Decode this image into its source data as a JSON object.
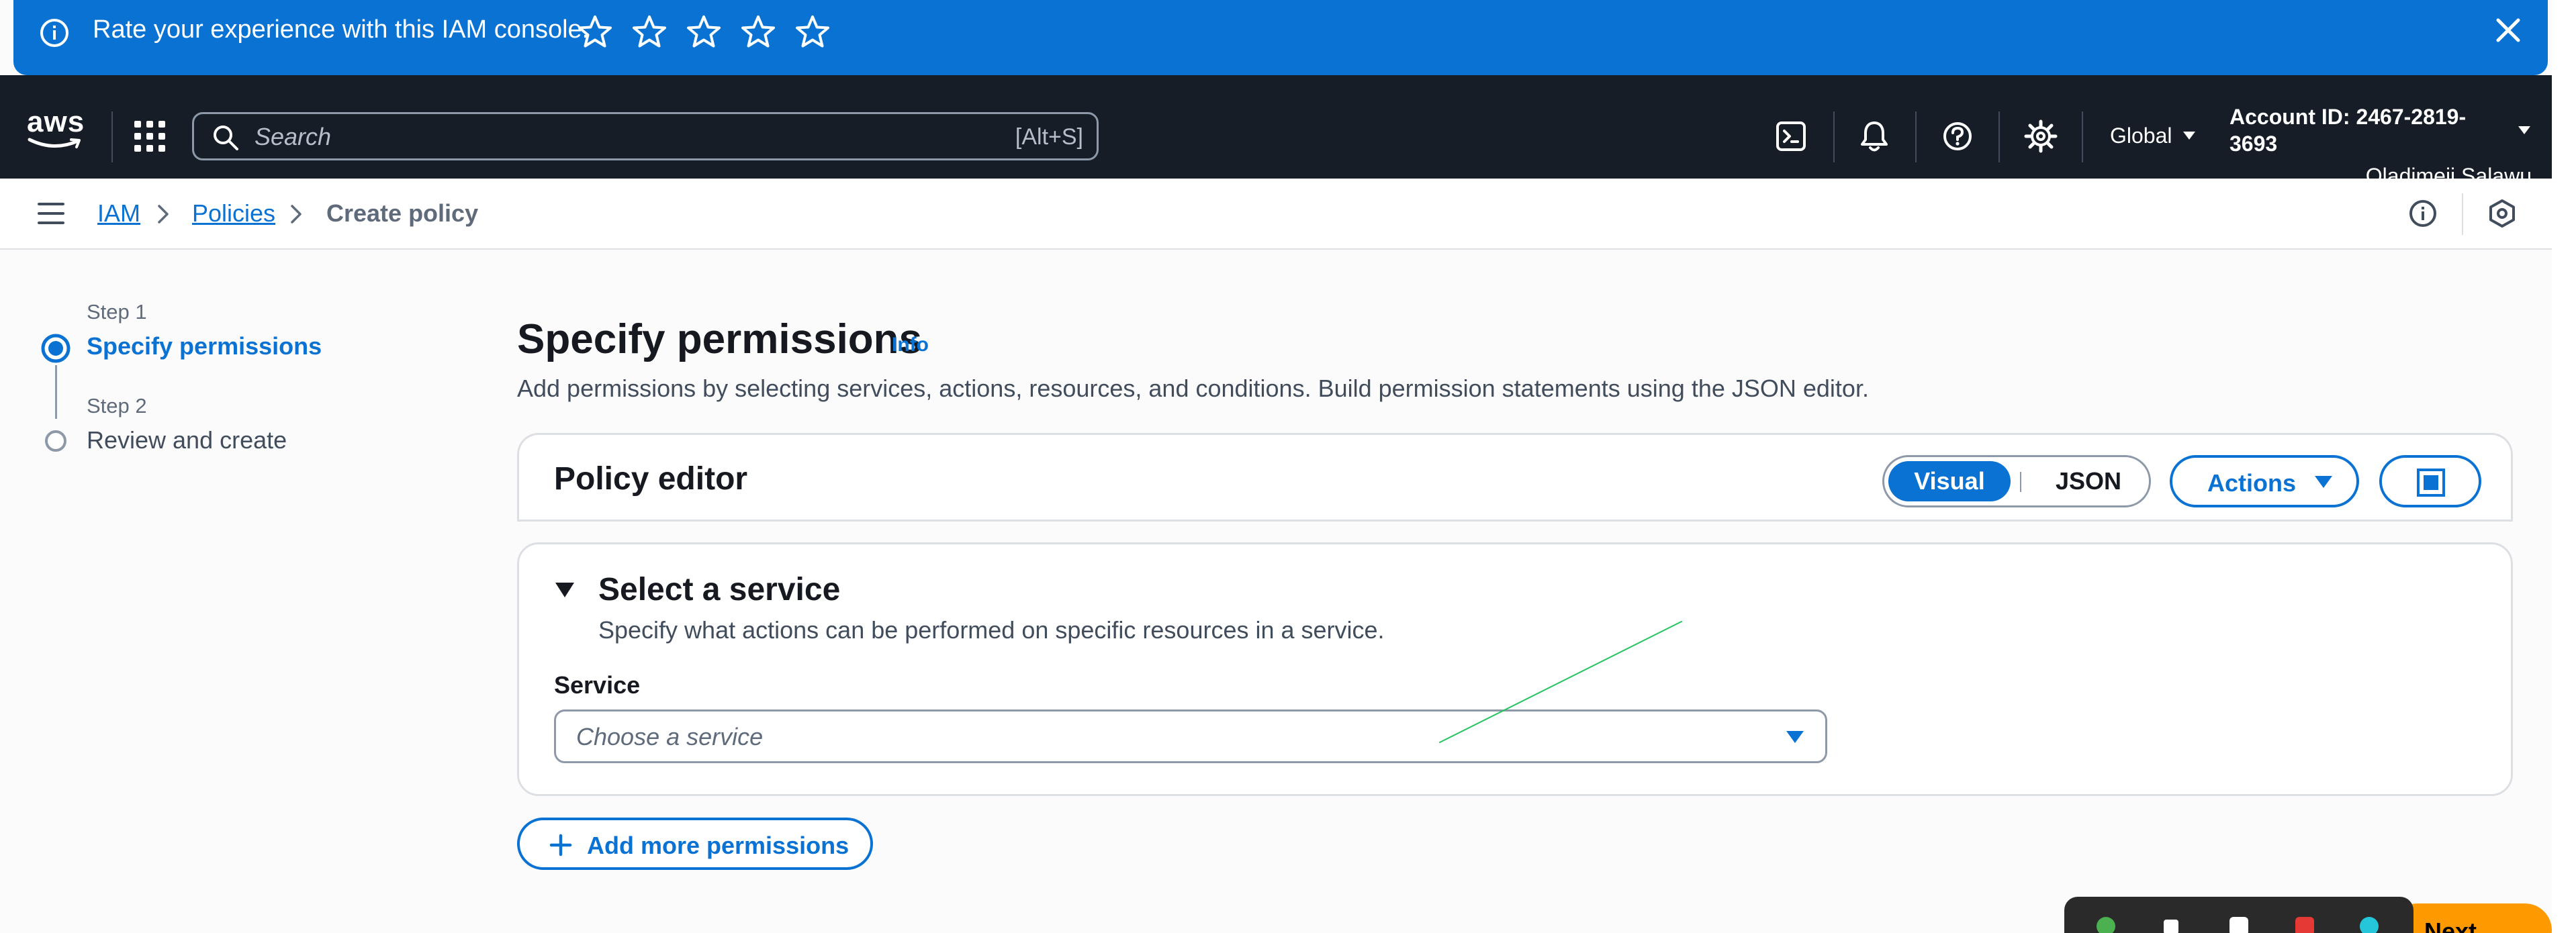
{
  "banner": {
    "text": "Rate your experience with this IAM console.",
    "star_count": 5,
    "rating_stars": [
      "star-icon",
      "star-icon",
      "star-icon",
      "star-icon",
      "star-icon"
    ]
  },
  "topnav": {
    "logo": "aws",
    "search": {
      "placeholder": "Search",
      "shortcut": "[Alt+S]"
    },
    "region": "Global",
    "account_id": "Account ID: 2467-2819-3693",
    "user_name": "Oladimeji Salawu"
  },
  "breadcrumb": {
    "items": [
      {
        "label": "IAM"
      },
      {
        "label": "Policies"
      },
      {
        "label": "Create policy"
      }
    ]
  },
  "steps": [
    {
      "step_label": "Step 1",
      "title": "Specify permissions",
      "active": true
    },
    {
      "step_label": "Step 2",
      "title": "Review and create",
      "active": false
    }
  ],
  "main": {
    "title": "Specify permissions",
    "info_link": "Info",
    "description": "Add permissions by selecting services, actions, resources, and conditions. Build permission statements using the JSON editor."
  },
  "policy_editor": {
    "title": "Policy editor",
    "mode_options": [
      "Visual",
      "JSON"
    ],
    "selected_mode": "Visual",
    "actions_label": "Actions"
  },
  "service_section": {
    "title": "Select a service",
    "description": "Specify what actions can be performed on specific resources in a service.",
    "field_label": "Service",
    "placeholder": "Choose a service"
  },
  "add_permissions_label": "Add more permissions",
  "next_label": "Next",
  "colors": {
    "accent": "#0972d3",
    "nav_bg": "#161d26",
    "primary_button": "#ff9900"
  }
}
